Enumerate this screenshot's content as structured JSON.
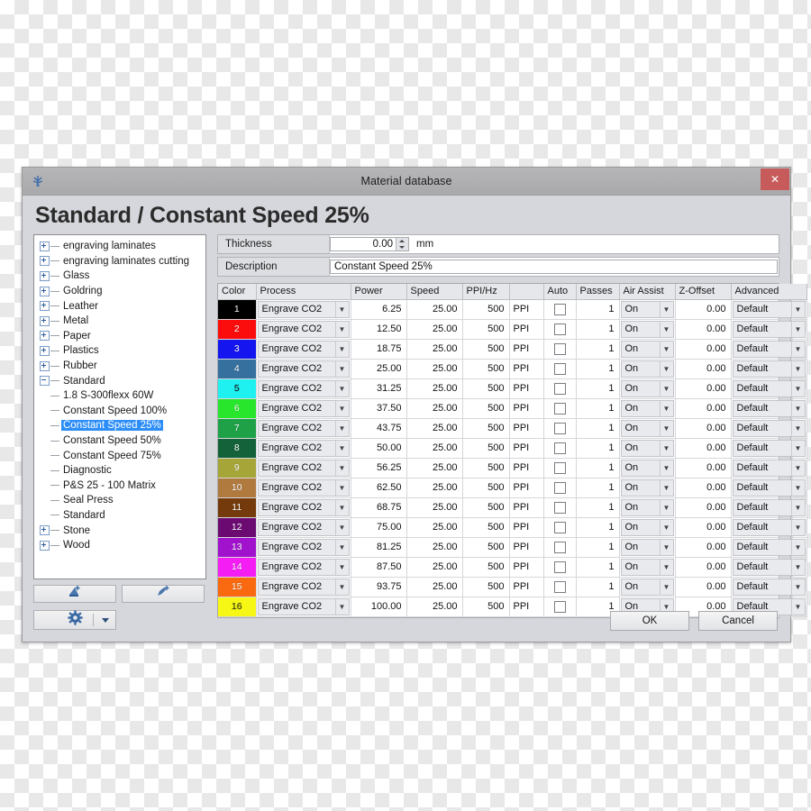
{
  "window": {
    "title": "Material database",
    "close_label": "✕",
    "icon": "app-icon"
  },
  "heading": "Standard / Constant Speed 25%",
  "tree": {
    "nodes": [
      {
        "label": "engraving laminates",
        "type": "parent",
        "expanded": false,
        "selected": false
      },
      {
        "label": "engraving laminates cutting",
        "type": "parent",
        "expanded": false,
        "selected": false
      },
      {
        "label": "Glass",
        "type": "parent",
        "expanded": false,
        "selected": false
      },
      {
        "label": "Goldring",
        "type": "parent",
        "expanded": false,
        "selected": false
      },
      {
        "label": "Leather",
        "type": "parent",
        "expanded": false,
        "selected": false
      },
      {
        "label": "Metal",
        "type": "parent",
        "expanded": false,
        "selected": false
      },
      {
        "label": "Paper",
        "type": "parent",
        "expanded": false,
        "selected": false
      },
      {
        "label": "Plastics",
        "type": "parent",
        "expanded": false,
        "selected": false
      },
      {
        "label": "Rubber",
        "type": "parent",
        "expanded": false,
        "selected": false
      },
      {
        "label": "Standard",
        "type": "parent",
        "expanded": true,
        "selected": false
      },
      {
        "label": "1.8 S-300flexx 60W",
        "type": "child",
        "selected": false
      },
      {
        "label": "Constant Speed 100%",
        "type": "child",
        "selected": false
      },
      {
        "label": "Constant Speed 25%",
        "type": "child",
        "selected": true
      },
      {
        "label": "Constant Speed 50%",
        "type": "child",
        "selected": false
      },
      {
        "label": "Constant Speed 75%",
        "type": "child",
        "selected": false
      },
      {
        "label": "Diagnostic",
        "type": "child",
        "selected": false
      },
      {
        "label": "P&S 25 - 100 Matrix",
        "type": "child",
        "selected": false
      },
      {
        "label": "Seal Press",
        "type": "child",
        "selected": false
      },
      {
        "label": "Standard",
        "type": "child",
        "selected": false
      },
      {
        "label": "Stone",
        "type": "parent",
        "expanded": false,
        "selected": false
      },
      {
        "label": "Wood",
        "type": "parent",
        "expanded": false,
        "selected": false
      }
    ]
  },
  "fields": {
    "thickness_label": "Thickness",
    "thickness_value": "0.00",
    "thickness_unit": "mm",
    "description_label": "Description",
    "description_value": "Constant Speed 25%"
  },
  "table": {
    "columns": [
      "Color",
      "Process",
      "Power",
      "Speed",
      "PPI/Hz",
      "",
      "Auto",
      "Passes",
      "Air Assist",
      "Z-Offset",
      "Advanced"
    ],
    "rows": [
      {
        "color_index": "1",
        "swatch": "#000000",
        "text_color": "#ffffff",
        "process": "Engrave CO2",
        "power": "6.25",
        "speed": "25.00",
        "ppi": "500",
        "ppi_unit": "PPI",
        "auto": false,
        "passes": "1",
        "air_assist": "On",
        "z_offset": "0.00",
        "advanced": "Default"
      },
      {
        "color_index": "2",
        "swatch": "#fc0d0d",
        "text_color": "#ffffff",
        "process": "Engrave CO2",
        "power": "12.50",
        "speed": "25.00",
        "ppi": "500",
        "ppi_unit": "PPI",
        "auto": false,
        "passes": "1",
        "air_assist": "On",
        "z_offset": "0.00",
        "advanced": "Default"
      },
      {
        "color_index": "3",
        "swatch": "#1515f0",
        "text_color": "#ffffff",
        "process": "Engrave CO2",
        "power": "18.75",
        "speed": "25.00",
        "ppi": "500",
        "ppi_unit": "PPI",
        "auto": false,
        "passes": "1",
        "air_assist": "On",
        "z_offset": "0.00",
        "advanced": "Default"
      },
      {
        "color_index": "4",
        "swatch": "#35709f",
        "text_color": "#ffffff",
        "process": "Engrave CO2",
        "power": "25.00",
        "speed": "25.00",
        "ppi": "500",
        "ppi_unit": "PPI",
        "auto": false,
        "passes": "1",
        "air_assist": "On",
        "z_offset": "0.00",
        "advanced": "Default"
      },
      {
        "color_index": "5",
        "swatch": "#1ff0f0",
        "text_color": "#1a1a1a",
        "process": "Engrave CO2",
        "power": "31.25",
        "speed": "25.00",
        "ppi": "500",
        "ppi_unit": "PPI",
        "auto": false,
        "passes": "1",
        "air_assist": "On",
        "z_offset": "0.00",
        "advanced": "Default"
      },
      {
        "color_index": "6",
        "swatch": "#27e62b",
        "text_color": "#ffffff",
        "process": "Engrave CO2",
        "power": "37.50",
        "speed": "25.00",
        "ppi": "500",
        "ppi_unit": "PPI",
        "auto": false,
        "passes": "1",
        "air_assist": "On",
        "z_offset": "0.00",
        "advanced": "Default"
      },
      {
        "color_index": "7",
        "swatch": "#1fa148",
        "text_color": "#ffffff",
        "process": "Engrave CO2",
        "power": "43.75",
        "speed": "25.00",
        "ppi": "500",
        "ppi_unit": "PPI",
        "auto": false,
        "passes": "1",
        "air_assist": "On",
        "z_offset": "0.00",
        "advanced": "Default"
      },
      {
        "color_index": "8",
        "swatch": "#13623a",
        "text_color": "#ffffff",
        "process": "Engrave CO2",
        "power": "50.00",
        "speed": "25.00",
        "ppi": "500",
        "ppi_unit": "PPI",
        "auto": false,
        "passes": "1",
        "air_assist": "On",
        "z_offset": "0.00",
        "advanced": "Default"
      },
      {
        "color_index": "9",
        "swatch": "#a5a538",
        "text_color": "#ffffff",
        "process": "Engrave CO2",
        "power": "56.25",
        "speed": "25.00",
        "ppi": "500",
        "ppi_unit": "PPI",
        "auto": false,
        "passes": "1",
        "air_assist": "On",
        "z_offset": "0.00",
        "advanced": "Default"
      },
      {
        "color_index": "10",
        "swatch": "#b07a3f",
        "text_color": "#ffffff",
        "process": "Engrave CO2",
        "power": "62.50",
        "speed": "25.00",
        "ppi": "500",
        "ppi_unit": "PPI",
        "auto": false,
        "passes": "1",
        "air_assist": "On",
        "z_offset": "0.00",
        "advanced": "Default"
      },
      {
        "color_index": "11",
        "swatch": "#743a0b",
        "text_color": "#ffffff",
        "process": "Engrave CO2",
        "power": "68.75",
        "speed": "25.00",
        "ppi": "500",
        "ppi_unit": "PPI",
        "auto": false,
        "passes": "1",
        "air_assist": "On",
        "z_offset": "0.00",
        "advanced": "Default"
      },
      {
        "color_index": "12",
        "swatch": "#6b0b72",
        "text_color": "#ffffff",
        "process": "Engrave CO2",
        "power": "75.00",
        "speed": "25.00",
        "ppi": "500",
        "ppi_unit": "PPI",
        "auto": false,
        "passes": "1",
        "air_assist": "On",
        "z_offset": "0.00",
        "advanced": "Default"
      },
      {
        "color_index": "13",
        "swatch": "#a112cd",
        "text_color": "#ffffff",
        "process": "Engrave CO2",
        "power": "81.25",
        "speed": "25.00",
        "ppi": "500",
        "ppi_unit": "PPI",
        "auto": false,
        "passes": "1",
        "air_assist": "On",
        "z_offset": "0.00",
        "advanced": "Default"
      },
      {
        "color_index": "14",
        "swatch": "#f41df4",
        "text_color": "#ffffff",
        "process": "Engrave CO2",
        "power": "87.50",
        "speed": "25.00",
        "ppi": "500",
        "ppi_unit": "PPI",
        "auto": false,
        "passes": "1",
        "air_assist": "On",
        "z_offset": "0.00",
        "advanced": "Default"
      },
      {
        "color_index": "15",
        "swatch": "#f96a10",
        "text_color": "#ffffff",
        "process": "Engrave CO2",
        "power": "93.75",
        "speed": "25.00",
        "ppi": "500",
        "ppi_unit": "PPI",
        "auto": false,
        "passes": "1",
        "air_assist": "On",
        "z_offset": "0.00",
        "advanced": "Default"
      },
      {
        "color_index": "16",
        "swatch": "#f7f715",
        "text_color": "#3a3a1a",
        "process": "Engrave CO2",
        "power": "100.00",
        "speed": "25.00",
        "ppi": "500",
        "ppi_unit": "PPI",
        "auto": false,
        "passes": "1",
        "air_assist": "On",
        "z_offset": "0.00",
        "advanced": "Default"
      }
    ]
  },
  "toolbar": {
    "import_icon": "import-material-icon",
    "new_icon": "new-material-icon",
    "settings_icon": "gear-icon",
    "settings_caret": "chevron-down-icon"
  },
  "footer": {
    "ok_label": "OK",
    "cancel_label": "Cancel"
  },
  "colors": {
    "dialog_bg": "#d6d7dc",
    "titlebar": "#b0b0b2",
    "close_red": "#c75b5b",
    "selection_blue": "#2e8ef7"
  }
}
